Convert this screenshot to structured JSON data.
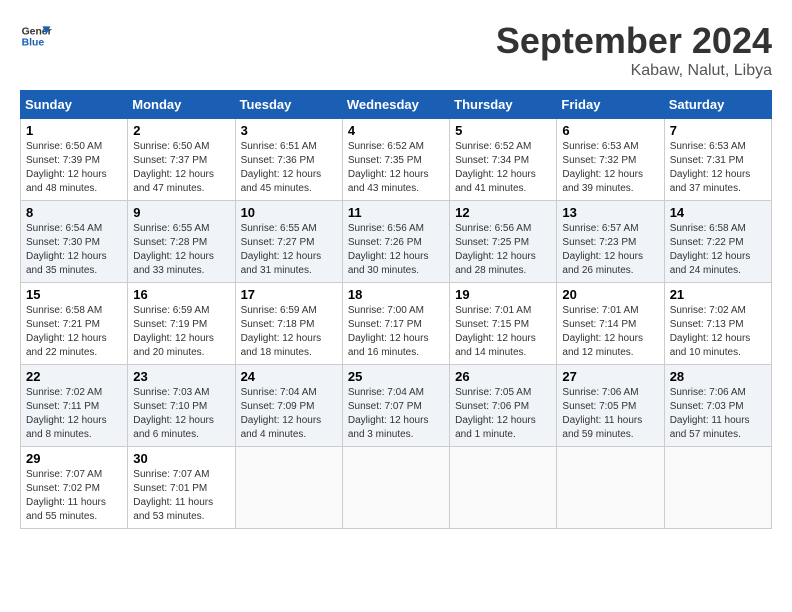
{
  "header": {
    "logo_line1": "General",
    "logo_line2": "Blue",
    "month_title": "September 2024",
    "location": "Kabaw, Nalut, Libya"
  },
  "weekdays": [
    "Sunday",
    "Monday",
    "Tuesday",
    "Wednesday",
    "Thursday",
    "Friday",
    "Saturday"
  ],
  "weeks": [
    [
      {
        "day": "1",
        "sunrise": "6:50 AM",
        "sunset": "7:39 PM",
        "daylight": "12 hours and 48 minutes."
      },
      {
        "day": "2",
        "sunrise": "6:50 AM",
        "sunset": "7:37 PM",
        "daylight": "12 hours and 47 minutes."
      },
      {
        "day": "3",
        "sunrise": "6:51 AM",
        "sunset": "7:36 PM",
        "daylight": "12 hours and 45 minutes."
      },
      {
        "day": "4",
        "sunrise": "6:52 AM",
        "sunset": "7:35 PM",
        "daylight": "12 hours and 43 minutes."
      },
      {
        "day": "5",
        "sunrise": "6:52 AM",
        "sunset": "7:34 PM",
        "daylight": "12 hours and 41 minutes."
      },
      {
        "day": "6",
        "sunrise": "6:53 AM",
        "sunset": "7:32 PM",
        "daylight": "12 hours and 39 minutes."
      },
      {
        "day": "7",
        "sunrise": "6:53 AM",
        "sunset": "7:31 PM",
        "daylight": "12 hours and 37 minutes."
      }
    ],
    [
      {
        "day": "8",
        "sunrise": "6:54 AM",
        "sunset": "7:30 PM",
        "daylight": "12 hours and 35 minutes."
      },
      {
        "day": "9",
        "sunrise": "6:55 AM",
        "sunset": "7:28 PM",
        "daylight": "12 hours and 33 minutes."
      },
      {
        "day": "10",
        "sunrise": "6:55 AM",
        "sunset": "7:27 PM",
        "daylight": "12 hours and 31 minutes."
      },
      {
        "day": "11",
        "sunrise": "6:56 AM",
        "sunset": "7:26 PM",
        "daylight": "12 hours and 30 minutes."
      },
      {
        "day": "12",
        "sunrise": "6:56 AM",
        "sunset": "7:25 PM",
        "daylight": "12 hours and 28 minutes."
      },
      {
        "day": "13",
        "sunrise": "6:57 AM",
        "sunset": "7:23 PM",
        "daylight": "12 hours and 26 minutes."
      },
      {
        "day": "14",
        "sunrise": "6:58 AM",
        "sunset": "7:22 PM",
        "daylight": "12 hours and 24 minutes."
      }
    ],
    [
      {
        "day": "15",
        "sunrise": "6:58 AM",
        "sunset": "7:21 PM",
        "daylight": "12 hours and 22 minutes."
      },
      {
        "day": "16",
        "sunrise": "6:59 AM",
        "sunset": "7:19 PM",
        "daylight": "12 hours and 20 minutes."
      },
      {
        "day": "17",
        "sunrise": "6:59 AM",
        "sunset": "7:18 PM",
        "daylight": "12 hours and 18 minutes."
      },
      {
        "day": "18",
        "sunrise": "7:00 AM",
        "sunset": "7:17 PM",
        "daylight": "12 hours and 16 minutes."
      },
      {
        "day": "19",
        "sunrise": "7:01 AM",
        "sunset": "7:15 PM",
        "daylight": "12 hours and 14 minutes."
      },
      {
        "day": "20",
        "sunrise": "7:01 AM",
        "sunset": "7:14 PM",
        "daylight": "12 hours and 12 minutes."
      },
      {
        "day": "21",
        "sunrise": "7:02 AM",
        "sunset": "7:13 PM",
        "daylight": "12 hours and 10 minutes."
      }
    ],
    [
      {
        "day": "22",
        "sunrise": "7:02 AM",
        "sunset": "7:11 PM",
        "daylight": "12 hours and 8 minutes."
      },
      {
        "day": "23",
        "sunrise": "7:03 AM",
        "sunset": "7:10 PM",
        "daylight": "12 hours and 6 minutes."
      },
      {
        "day": "24",
        "sunrise": "7:04 AM",
        "sunset": "7:09 PM",
        "daylight": "12 hours and 4 minutes."
      },
      {
        "day": "25",
        "sunrise": "7:04 AM",
        "sunset": "7:07 PM",
        "daylight": "12 hours and 3 minutes."
      },
      {
        "day": "26",
        "sunrise": "7:05 AM",
        "sunset": "7:06 PM",
        "daylight": "12 hours and 1 minute."
      },
      {
        "day": "27",
        "sunrise": "7:06 AM",
        "sunset": "7:05 PM",
        "daylight": "11 hours and 59 minutes."
      },
      {
        "day": "28",
        "sunrise": "7:06 AM",
        "sunset": "7:03 PM",
        "daylight": "11 hours and 57 minutes."
      }
    ],
    [
      {
        "day": "29",
        "sunrise": "7:07 AM",
        "sunset": "7:02 PM",
        "daylight": "11 hours and 55 minutes."
      },
      {
        "day": "30",
        "sunrise": "7:07 AM",
        "sunset": "7:01 PM",
        "daylight": "11 hours and 53 minutes."
      },
      null,
      null,
      null,
      null,
      null
    ]
  ]
}
